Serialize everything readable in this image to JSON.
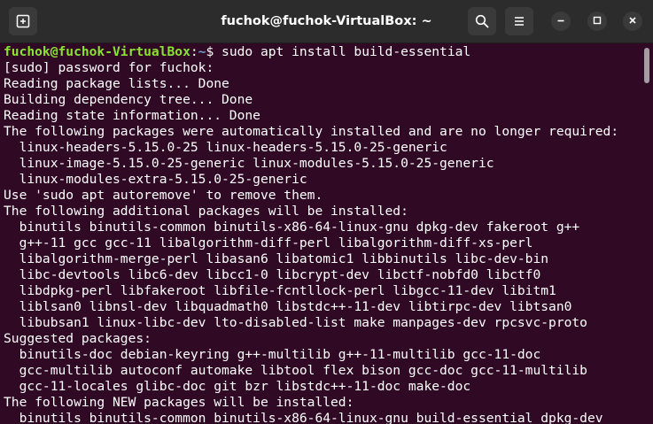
{
  "window": {
    "title": "fuchok@fuchok-VirtualBox: ~",
    "icons": {
      "new_tab": "new-tab-icon",
      "search": "search-icon",
      "menu": "hamburger-menu-icon",
      "minimize": "minimize-icon",
      "maximize": "maximize-icon",
      "close": "close-icon"
    }
  },
  "colors": {
    "background": "#300a24",
    "titlebar": "#2c2c2c",
    "prompt_user": "#8ae234",
    "prompt_path": "#729fcf",
    "text": "#ffffff"
  },
  "terminal": {
    "prompt": {
      "user_host": "fuchok@fuchok-VirtualBox",
      "separator": ":",
      "path": "~",
      "symbol": "$ ",
      "command": "sudo apt install build-essential"
    },
    "lines": [
      "[sudo] password for fuchok:",
      "Reading package lists... Done",
      "Building dependency tree... Done",
      "Reading state information... Done",
      "The following packages were automatically installed and are no longer required:",
      "  linux-headers-5.15.0-25 linux-headers-5.15.0-25-generic",
      "  linux-image-5.15.0-25-generic linux-modules-5.15.0-25-generic",
      "  linux-modules-extra-5.15.0-25-generic",
      "Use 'sudo apt autoremove' to remove them.",
      "The following additional packages will be installed:",
      "  binutils binutils-common binutils-x86-64-linux-gnu dpkg-dev fakeroot g++",
      "  g++-11 gcc gcc-11 libalgorithm-diff-perl libalgorithm-diff-xs-perl",
      "  libalgorithm-merge-perl libasan6 libatomic1 libbinutils libc-dev-bin",
      "  libc-devtools libc6-dev libcc1-0 libcrypt-dev libctf-nobfd0 libctf0",
      "  libdpkg-perl libfakeroot libfile-fcntllock-perl libgcc-11-dev libitm1",
      "  liblsan0 libnsl-dev libquadmath0 libstdc++-11-dev libtirpc-dev libtsan0",
      "  libubsan1 linux-libc-dev lto-disabled-list make manpages-dev rpcsvc-proto",
      "Suggested packages:",
      "  binutils-doc debian-keyring g++-multilib g++-11-multilib gcc-11-doc",
      "  gcc-multilib autoconf automake libtool flex bison gcc-doc gcc-11-multilib",
      "  gcc-11-locales glibc-doc git bzr libstdc++-11-doc make-doc",
      "The following NEW packages will be installed:",
      "  binutils binutils-common binutils-x86-64-linux-gnu build-essential dpkg-dev"
    ]
  }
}
